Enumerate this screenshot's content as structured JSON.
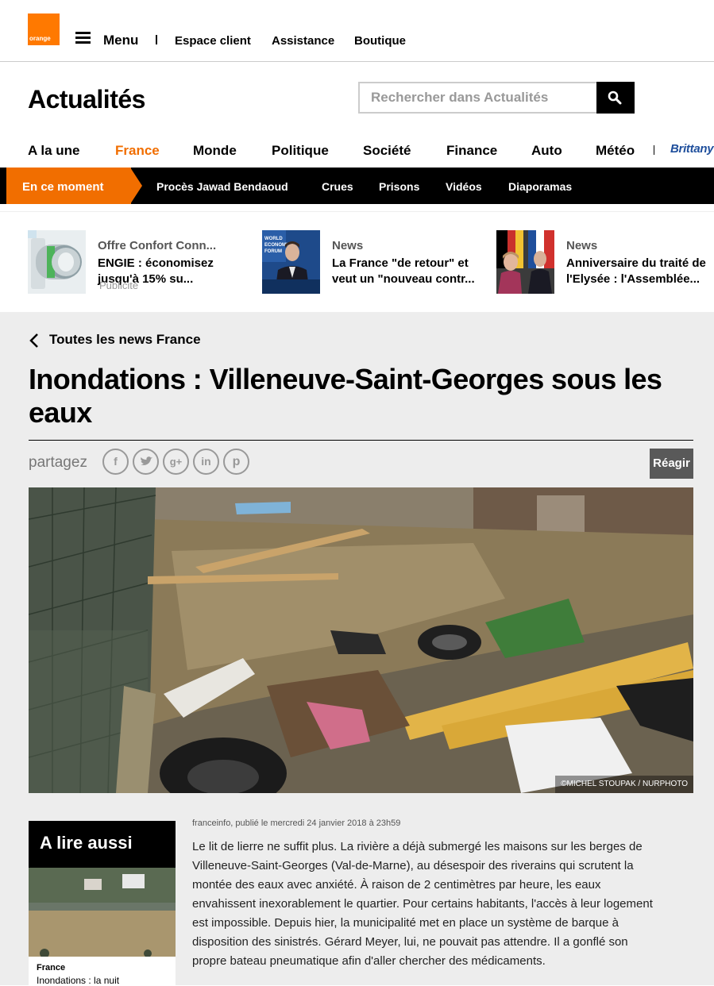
{
  "header": {
    "logo_text": "orange",
    "menu_label": "Menu",
    "links": [
      "Espace client",
      "Assistance",
      "Boutique"
    ]
  },
  "brand": {
    "title": "Actualités",
    "search_placeholder": "Rechercher dans Actualités"
  },
  "nav": {
    "items": [
      "A la une",
      "France",
      "Monde",
      "Politique",
      "Société",
      "Finance",
      "Auto",
      "Météo"
    ],
    "active": "France",
    "partner": "Brittany"
  },
  "hot": {
    "label": "En ce moment",
    "links": [
      "Procès Jawad Bendaoud",
      "Crues",
      "Prisons",
      "Vidéos",
      "Diaporamas"
    ]
  },
  "promos": [
    {
      "category": "Offre Confort Conn...",
      "title_lines": [
        "ENGIE : économisez",
        "jusqu'à 15% su..."
      ],
      "tag": "Publicité"
    },
    {
      "category": "News",
      "title_lines": [
        "La France \"de retour\" et",
        "veut un \"nouveau contr..."
      ]
    },
    {
      "category": "News",
      "title_lines": [
        "Anniversaire du traité de",
        "l'Elysée : l'Assemblée..."
      ]
    }
  ],
  "article": {
    "back_label": "Toutes les news France",
    "title": "Inondations : Villeneuve-Saint-Georges sous les eaux",
    "share_label": "partagez",
    "react_label": "Réagir",
    "photo_credit": "©MICHEL STOUPAK / NURPHOTO",
    "byline": "franceinfo, publié le mercredi 24 janvier 2018 à 23h59",
    "lines": [
      "Le lit de lierre ne suffit plus. La rivière a déjà submergé les maisons sur les berges de",
      "Villeneuve-Saint-Georges (Val-de-Marne), au désespoir des riverains qui scrutent la",
      "montée des eaux avec anxiété. À raison de 2 centimètres par heure, les eaux",
      "envahissent inexorablement le quartier. Pour certains habitants, l'accès à leur logement",
      "est impossible. Depuis hier, la municipalité met en place un système de barque à",
      "disposition des sinistrés. Gérard Meyer, lui, ne pouvait pas attendre. Il a gonflé son",
      "propre bateau pneumatique afin d'aller chercher des médicaments."
    ]
  },
  "aside": {
    "heading": "A lire aussi",
    "category": "France",
    "title": "Inondations : la nuit"
  },
  "colors": {
    "accent": "#f16e00",
    "dark": "#000000",
    "page_bg": "#ededed"
  }
}
